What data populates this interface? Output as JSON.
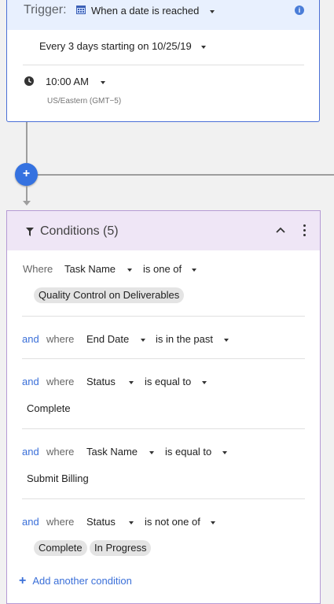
{
  "trigger": {
    "label": "Trigger:",
    "type_value": "When a date is reached",
    "recurrence": "Every 3 days starting on 10/25/19",
    "time": "10:00 AM",
    "timezone": "US/Eastern (GMT−5)"
  },
  "connector": {
    "add_symbol": "+"
  },
  "conditions": {
    "title": "Conditions (5)",
    "rows": [
      {
        "prefix": "",
        "where": "Where",
        "field": "Task Name",
        "operator": "is one of",
        "values": [
          "Quality Control on Deliverables"
        ]
      },
      {
        "prefix": "and",
        "where": "where",
        "field": "End Date",
        "operator": "is in the past",
        "values": []
      },
      {
        "prefix": "and",
        "where": "where",
        "field": "Status",
        "operator": "is equal to",
        "text_value": "Complete"
      },
      {
        "prefix": "and",
        "where": "where",
        "field": "Task Name",
        "operator": "is equal to",
        "text_value": "Submit Billing"
      },
      {
        "prefix": "and",
        "where": "where",
        "field": "Status",
        "operator": "is not one of",
        "values": [
          "Complete",
          "In Progress"
        ]
      }
    ],
    "add_label": "Add another condition",
    "add_symbol": "+"
  },
  "colors": {
    "trigger_header_bg": "#e8f0fe",
    "trigger_border": "#4a6fd6",
    "conditions_header_bg": "#efe6f6",
    "conditions_border": "#b59ad4",
    "accent_blue": "#3a6fd8",
    "add_step_button": "#3572e0",
    "chip_bg": "#e4e4e4"
  },
  "icons": [
    "calendar-icon",
    "info-icon",
    "clock-icon",
    "plus-icon",
    "filter-icon",
    "chevron-up-icon",
    "more-vert-icon"
  ]
}
